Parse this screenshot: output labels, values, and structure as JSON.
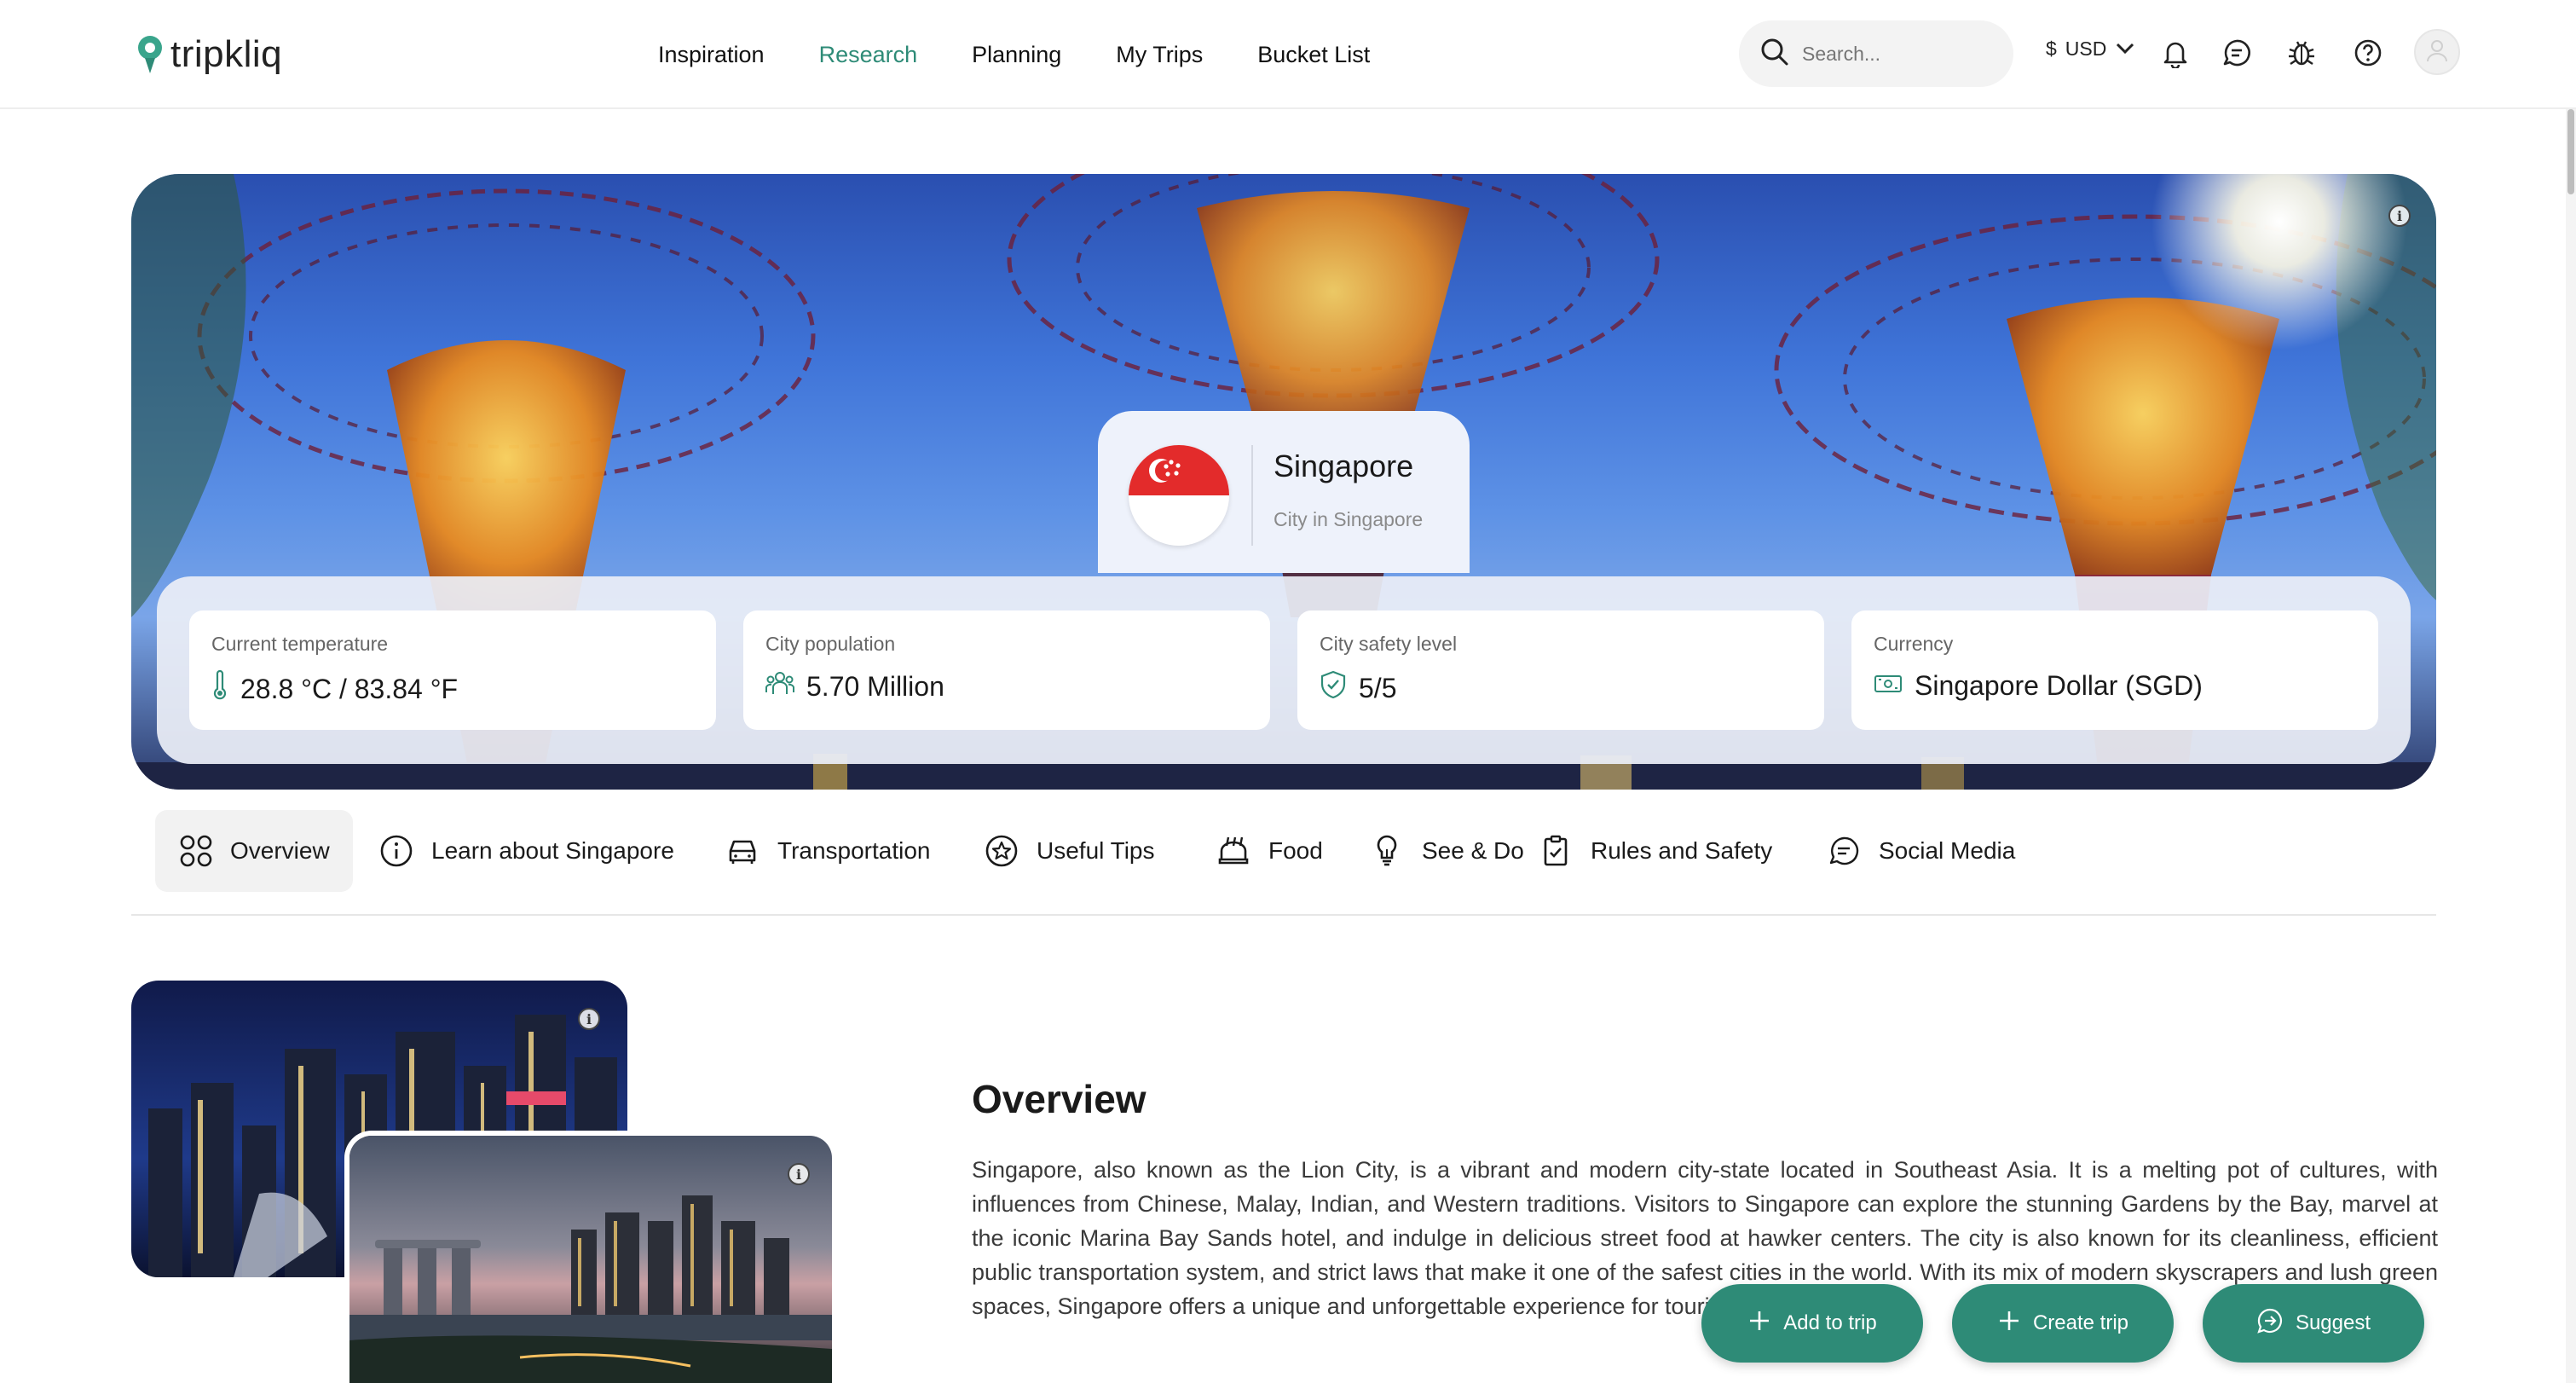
{
  "brand": {
    "name": "tripkliq",
    "accent": "#2e8b77"
  },
  "nav": {
    "items": [
      {
        "label": "Inspiration",
        "active": false
      },
      {
        "label": "Research",
        "active": true
      },
      {
        "label": "Planning",
        "active": false
      },
      {
        "label": "My Trips",
        "active": false
      },
      {
        "label": "Bucket List",
        "active": false
      }
    ]
  },
  "header": {
    "search_placeholder": "Search...",
    "currency_symbol": "$",
    "currency_code": "USD",
    "icons": [
      "search-icon",
      "chevron-down-icon",
      "bell-icon",
      "chat-icon",
      "bug-icon",
      "help-icon",
      "user-icon"
    ]
  },
  "city": {
    "name": "Singapore",
    "subtitle": "City in Singapore",
    "flag_colors": [
      "#e32b2b",
      "#ffffff"
    ]
  },
  "stats": [
    {
      "label": "Current temperature",
      "value": "28.8 °C / 83.84 °F",
      "icon": "thermometer-icon"
    },
    {
      "label": "City population",
      "value": "5.70 Million",
      "icon": "people-icon"
    },
    {
      "label": "City safety level",
      "value": "5/5",
      "icon": "shield-check-icon"
    },
    {
      "label": "Currency",
      "value": "Singapore Dollar (SGD)",
      "icon": "banknote-icon"
    }
  ],
  "tabs": [
    {
      "label": "Overview",
      "icon": "grid-icon",
      "active": true
    },
    {
      "label": "Learn about Singapore",
      "icon": "info-icon",
      "active": false
    },
    {
      "label": "Transportation",
      "icon": "car-icon",
      "active": false
    },
    {
      "label": "Useful Tips",
      "icon": "star-badge-icon",
      "active": false
    },
    {
      "label": "Food",
      "icon": "food-icon",
      "active": false
    },
    {
      "label": "See & Do",
      "icon": "lightbulb-icon",
      "active": false
    },
    {
      "label": "Rules and Safety",
      "icon": "clipboard-check-icon",
      "active": false
    },
    {
      "label": "Social Media",
      "icon": "chat-bubble-icon",
      "active": false
    }
  ],
  "overview": {
    "title": "Overview",
    "text": "Singapore, also known as the Lion City, is a vibrant and modern city-state located in Southeast Asia. It is a melting pot of cultures, with influences from Chinese, Malay, Indian, and Western traditions. Visitors to Singapore can explore the stunning Gardens by the Bay, marvel at the iconic Marina Bay Sands hotel, and indulge in delicious street food at hawker centers. The city is also known for its cleanliness, efficient public transportation system, and strict laws that make it one of the safest cities in the world. With its mix of modern skyscrapers and lush green spaces, Singapore offers a unique and unforgettable experience for tourists."
  },
  "actions": {
    "add_to_trip": "Add to trip",
    "create_trip": "Create trip",
    "suggest": "Suggest"
  }
}
